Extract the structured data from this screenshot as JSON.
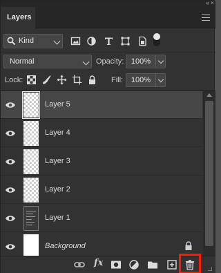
{
  "panel": {
    "tab_label": "Layers",
    "collapse_glyph": "‹‹",
    "close_glyph": "×"
  },
  "filter": {
    "kind_label": "Kind",
    "icons": [
      "pixel-filter-icon",
      "adjustment-filter-icon",
      "type-filter-icon",
      "shape-filter-icon",
      "smart-object-filter-icon"
    ]
  },
  "blend": {
    "mode": "Normal",
    "opacity_label": "Opacity:",
    "opacity_value": "100%",
    "lock_label": "Lock:",
    "fill_label": "Fill:",
    "fill_value": "100%"
  },
  "layers": [
    {
      "name": "Layer 5",
      "selected": true
    },
    {
      "name": "Layer 4",
      "selected": false
    },
    {
      "name": "Layer 3",
      "selected": false
    },
    {
      "name": "Layer 2",
      "selected": false
    },
    {
      "name": "Layer 1",
      "selected": false
    },
    {
      "name": "Background",
      "selected": false,
      "locked": true
    }
  ],
  "bottom_bar": {
    "fx_label": "fx",
    "icons": [
      "link-layers-icon",
      "layer-style-icon",
      "add-mask-icon",
      "adjustment-layer-icon",
      "new-group-icon",
      "new-layer-icon",
      "delete-layer-icon"
    ],
    "highlight_color": "#ff1a00"
  },
  "colors": {
    "panel_bg": "#323232",
    "selected_row": "#474747"
  }
}
